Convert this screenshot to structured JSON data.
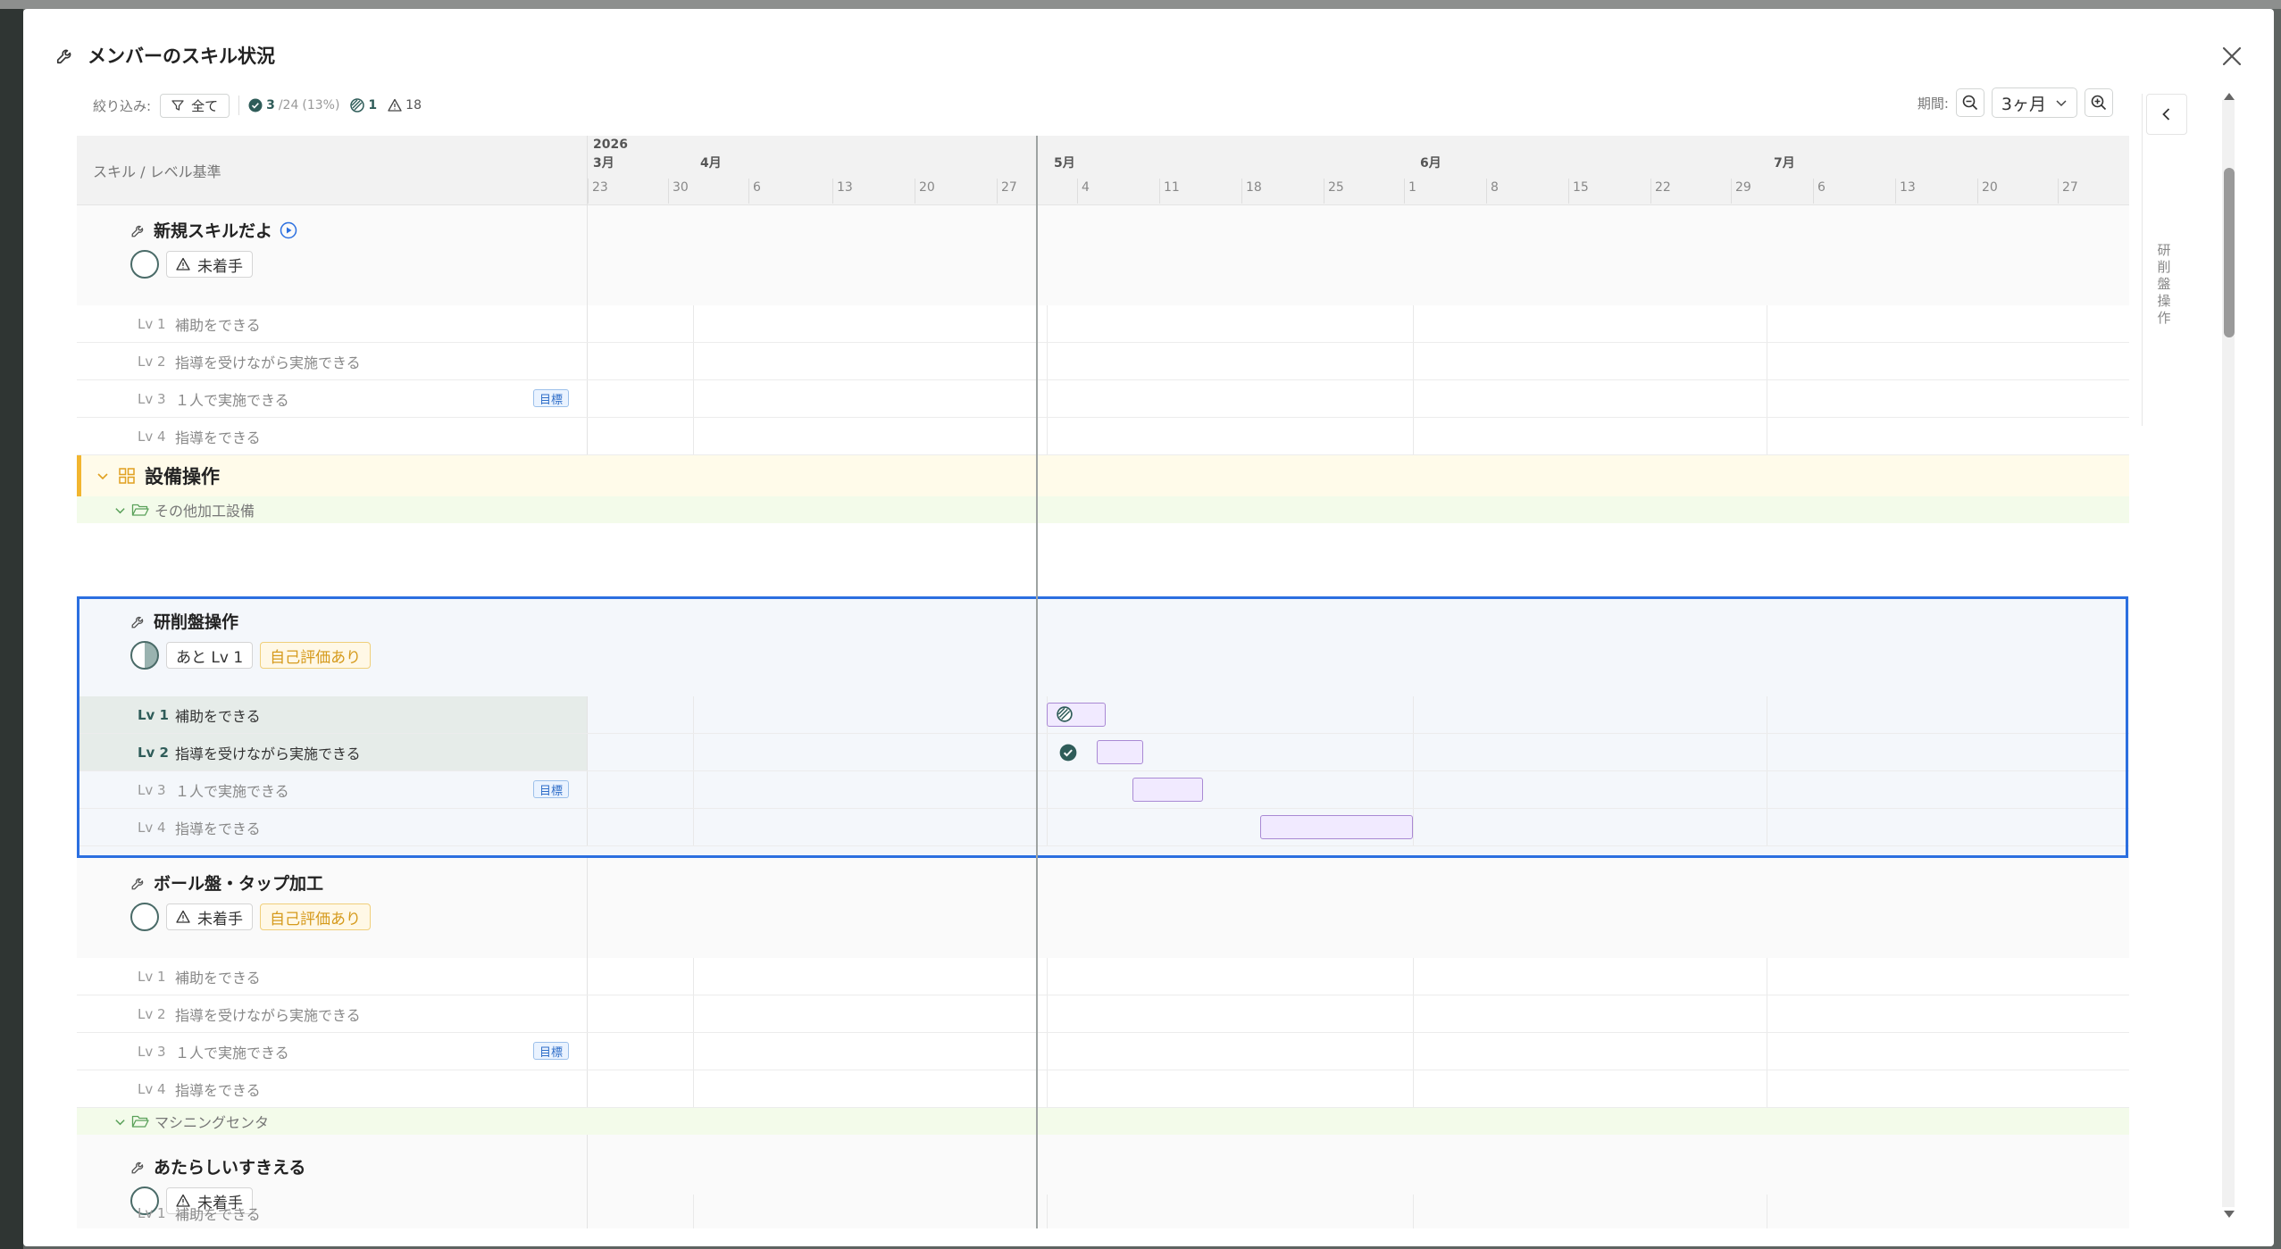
{
  "modal": {
    "title": "メンバーのスキル状況"
  },
  "toolbar": {
    "filter_label": "絞り込み:",
    "filter_value": "全て",
    "stat_done": "3",
    "stat_total": "/24",
    "stat_percent": "(13%)",
    "stat_progress": "1",
    "stat_warn": "18"
  },
  "period": {
    "label": "期間:",
    "value": "3ヶ月"
  },
  "grid_header": {
    "left_label": "スキル / レベル基準"
  },
  "timeline": {
    "year": "2026",
    "months": [
      "3月",
      "4月",
      "5月",
      "6月",
      "7月"
    ],
    "weeks": [
      "23",
      "30",
      "6",
      "13",
      "20",
      "27",
      "4",
      "11",
      "18",
      "25",
      "1",
      "8",
      "15",
      "22",
      "29",
      "6",
      "13",
      "20",
      "27"
    ]
  },
  "levels": {
    "lv1": {
      "num": "Lv 1",
      "label": "補助をできる"
    },
    "lv2": {
      "num": "Lv 2",
      "label": "指導を受けながら実施できる"
    },
    "lv3": {
      "num": "Lv 3",
      "label": "１人で実施できる"
    },
    "lv4": {
      "num": "Lv 4",
      "label": "指導をできる"
    },
    "goal": "目標"
  },
  "skills": {
    "s1": {
      "name": "新規スキルだよ",
      "status": "未着手"
    },
    "s2": {
      "name": "研削盤操作",
      "status": "あと Lv 1",
      "self": "自己評価あり"
    },
    "s3": {
      "name": "ボール盤・タップ加工",
      "status": "未着手",
      "self": "自己評価あり"
    },
    "s4": {
      "name": "あたらしいすきえる",
      "status": "未着手"
    }
  },
  "category": {
    "name": "設備操作"
  },
  "subcategories": {
    "sub1": "その他加工設備",
    "sub2": "マシニングセンタ"
  },
  "sidebar": {
    "vertical_label": "研削盤操作"
  },
  "colors": {
    "accent": "#2b6fe0",
    "bar_border": "#a989d4",
    "bar_fill": "#f1eaff",
    "done": "#2f5c59",
    "category": "#f2b52f"
  }
}
